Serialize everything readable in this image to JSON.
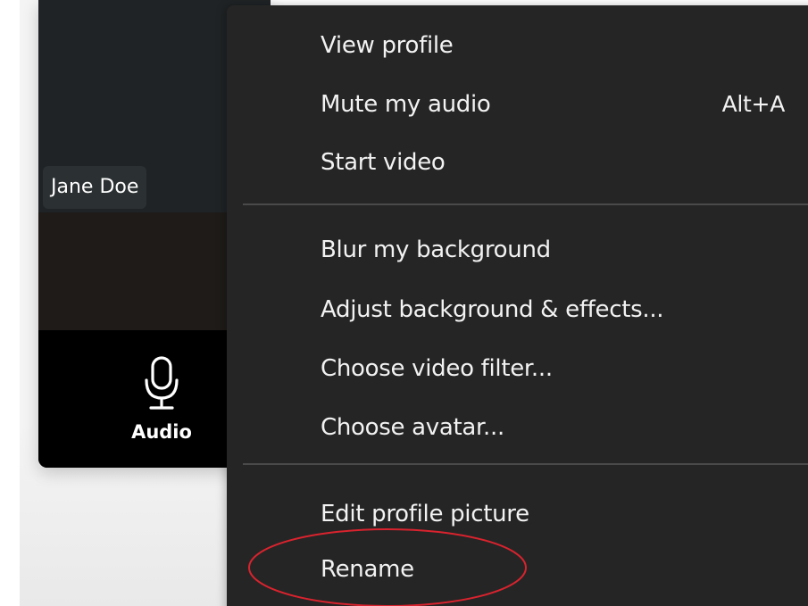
{
  "video_tile": {
    "participant_name": "Jane Doe",
    "audio_button_label": "Audio",
    "audio_icon": "microphone-icon"
  },
  "context_menu": {
    "groups": [
      {
        "items": [
          {
            "label": "View profile",
            "shortcut": ""
          },
          {
            "label": "Mute my audio",
            "shortcut": "Alt+A"
          },
          {
            "label": "Start video",
            "shortcut": ""
          }
        ]
      },
      {
        "items": [
          {
            "label": "Blur my background",
            "shortcut": ""
          },
          {
            "label": "Adjust background & effects...",
            "shortcut": ""
          },
          {
            "label": "Choose video filter...",
            "shortcut": ""
          },
          {
            "label": "Choose avatar...",
            "shortcut": ""
          }
        ]
      },
      {
        "items": [
          {
            "label": "Edit profile picture",
            "shortcut": ""
          },
          {
            "label": "Rename",
            "shortcut": ""
          }
        ]
      }
    ]
  },
  "annotation": {
    "highlight_color": "#d9232e",
    "highlighted_item": "Rename"
  },
  "colors": {
    "menu_background": "#252525",
    "menu_text": "#f2f2f2",
    "tile_background": "#000000"
  }
}
